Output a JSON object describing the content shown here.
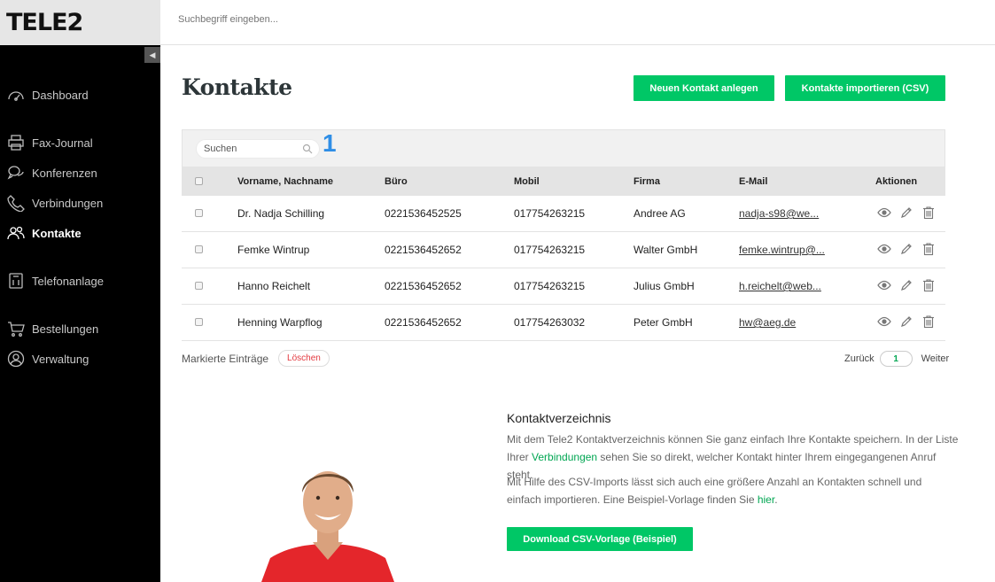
{
  "brand": {
    "logo": "TELE2",
    "accent": "#00c766"
  },
  "topbar": {
    "search_placeholder": "Suchbegriff eingeben..."
  },
  "sidebar": {
    "collapse_icon": "triangle-left",
    "items": [
      {
        "label": "Dashboard",
        "icon": "speedometer-icon",
        "active": false
      },
      {
        "label": "Fax-Journal",
        "icon": "printer-icon",
        "active": false
      },
      {
        "label": "Konferenzen",
        "icon": "chat-icon",
        "active": false
      },
      {
        "label": "Verbindungen",
        "icon": "phone-icon",
        "active": false
      },
      {
        "label": "Kontakte",
        "icon": "contacts-icon",
        "active": true
      },
      {
        "label": "Telefonanlage",
        "icon": "switchboard-icon",
        "active": false
      },
      {
        "label": "Bestellungen",
        "icon": "cart-icon",
        "active": false
      },
      {
        "label": "Verwaltung",
        "icon": "user-circle-icon",
        "active": false
      }
    ]
  },
  "main": {
    "title": "Kontakte",
    "btn_new": "Neuen Kontakt anlegen",
    "btn_import": "Kontakte importieren (CSV)",
    "search_placeholder": "Suchen",
    "marker": "1",
    "columns": [
      "Vorname, Nachname",
      "Büro",
      "Mobil",
      "Firma",
      "E-Mail",
      "Aktionen"
    ],
    "rows": [
      {
        "name": "Dr. Nadja Schilling",
        "buero": "0221536452525",
        "mobil": "017754263215",
        "firma": "Andree AG",
        "email": "nadja-s98@we..."
      },
      {
        "name": "Femke Wintrup",
        "buero": "0221536452652",
        "mobil": "017754263215",
        "firma": "Walter GmbH",
        "email": "femke.wintrup@..."
      },
      {
        "name": "Hanno Reichelt",
        "buero": "0221536452652",
        "mobil": "017754263215",
        "firma": "Julius GmbH",
        "email": "h.reichelt@web..."
      },
      {
        "name": "Henning Warpflog",
        "buero": "0221536452652",
        "mobil": "017754263032",
        "firma": "Peter GmbH",
        "email": "hw@aeg.de"
      }
    ],
    "marked_label": "Markierte Einträge",
    "delete_label": "Löschen",
    "pager": {
      "prev": "Zurück",
      "page": "1",
      "next": "Weiter"
    }
  },
  "info": {
    "title": "Kontaktverzeichnis",
    "p1_a": "Mit dem Tele2 Kontaktverzeichnis können Sie ganz einfach Ihre Kontakte speichern. In der Liste Ihrer ",
    "p1_link": "Verbindungen",
    "p1_b": " sehen Sie so direkt, welcher Kontakt hinter Ihrem eingegangenen Anruf steht.",
    "p2_a": "Mit Hilfe des CSV-Imports lässt sich auch eine größere Anzahl an Kontakten schnell und einfach importieren. Eine Beispiel-Vorlage finden Sie ",
    "p2_link": "hier",
    "p2_b": ".",
    "btn_download": "Download CSV-Vorlage (Beispiel)"
  }
}
